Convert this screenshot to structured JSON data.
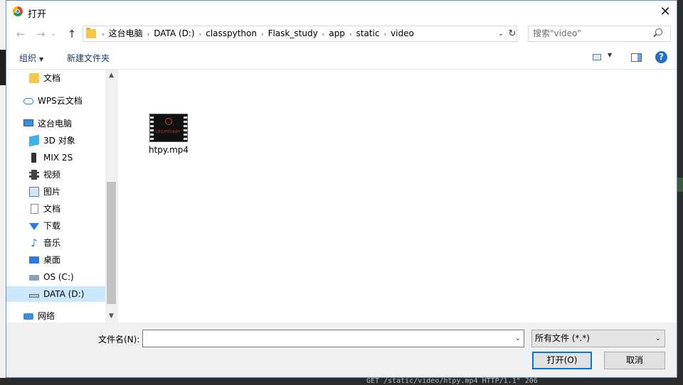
{
  "window": {
    "title": "打开",
    "close_label": "✕"
  },
  "nav": {
    "back_glyph": "←",
    "forward_glyph": "→",
    "recent_glyph": "⌄",
    "up_glyph": "↑",
    "breadcrumbs": [
      "这台电脑",
      "DATA (D:)",
      "classpython",
      "Flask_study",
      "app",
      "static",
      "video"
    ],
    "separator": "›",
    "search_placeholder": "搜索\"video\""
  },
  "toolbar": {
    "organize_label": "组织",
    "new_folder_label": "新建文件夹",
    "help_label": "?"
  },
  "sidebar": {
    "items": [
      {
        "label": "文档",
        "icon": "folder-icon"
      },
      {
        "label": "WPS云文档",
        "icon": "cloud-icon"
      },
      {
        "label": "这台电脑",
        "icon": "computer-icon"
      },
      {
        "label": "3D 对象",
        "icon": "cube-icon"
      },
      {
        "label": "MIX 2S",
        "icon": "phone-icon"
      },
      {
        "label": "视频",
        "icon": "video-icon"
      },
      {
        "label": "图片",
        "icon": "pictures-icon"
      },
      {
        "label": "文档",
        "icon": "document-icon"
      },
      {
        "label": "下载",
        "icon": "download-icon"
      },
      {
        "label": "音乐",
        "icon": "music-icon"
      },
      {
        "label": "桌面",
        "icon": "desktop-icon"
      },
      {
        "label": "OS (C:)",
        "icon": "drive-icon"
      },
      {
        "label": "DATA (D:)",
        "icon": "drive-icon",
        "selected": true
      },
      {
        "label": "网络",
        "icon": "network-icon"
      }
    ]
  },
  "files": [
    {
      "name": "htpy.mp4",
      "thumbnail_text": "LEGENDARY"
    }
  ],
  "bottom": {
    "filename_label": "文件名(N):",
    "filename_value": "",
    "filetype_value": "所有文件 (*.*)",
    "open_label": "打开(O)",
    "cancel_label": "取消"
  },
  "background": {
    "code_snippet": "GET /static/video/htpy.mp4 HTTP/1.1\" 206"
  }
}
